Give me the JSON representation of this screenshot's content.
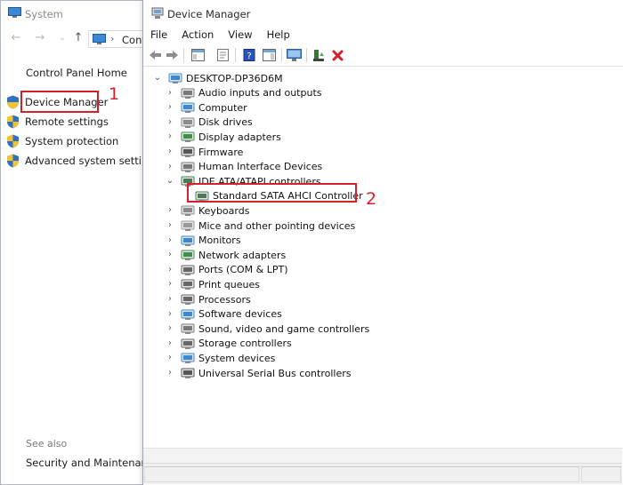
{
  "system_window": {
    "title": "System",
    "address_text": "Cont",
    "control_panel_home": "Control Panel Home",
    "tasks": [
      {
        "label": "Device Manager"
      },
      {
        "label": "Remote settings"
      },
      {
        "label": "System protection"
      },
      {
        "label": "Advanced system settings"
      }
    ],
    "see_also": "See also",
    "security_and_maintenance": "Security and Maintenance"
  },
  "device_manager": {
    "title": "Device Manager",
    "menu": [
      "File",
      "Action",
      "View",
      "Help"
    ],
    "root": "DESKTOP-DP36D6M",
    "categories": [
      {
        "label": "Audio inputs and outputs",
        "icon": "speaker-icon"
      },
      {
        "label": "Computer",
        "icon": "computer-icon"
      },
      {
        "label": "Disk drives",
        "icon": "disk-drive-icon"
      },
      {
        "label": "Display adapters",
        "icon": "display-adapter-icon"
      },
      {
        "label": "Firmware",
        "icon": "firmware-chip-icon"
      },
      {
        "label": "Human Interface Devices",
        "icon": "hid-icon"
      },
      {
        "label": "IDE ATA/ATAPI controllers",
        "icon": "ide-controller-icon",
        "expanded": true,
        "children": [
          {
            "label": "Standard SATA AHCI Controller",
            "icon": "sata-controller-icon"
          }
        ]
      },
      {
        "label": "Keyboards",
        "icon": "keyboard-icon"
      },
      {
        "label": "Mice and other pointing devices",
        "icon": "mouse-icon"
      },
      {
        "label": "Monitors",
        "icon": "monitor-icon"
      },
      {
        "label": "Network adapters",
        "icon": "network-adapter-icon"
      },
      {
        "label": "Ports (COM & LPT)",
        "icon": "port-icon"
      },
      {
        "label": "Print queues",
        "icon": "printer-icon"
      },
      {
        "label": "Processors",
        "icon": "processor-icon"
      },
      {
        "label": "Software devices",
        "icon": "software-device-icon"
      },
      {
        "label": "Sound, video and game controllers",
        "icon": "sound-controller-icon"
      },
      {
        "label": "Storage controllers",
        "icon": "storage-controller-icon"
      },
      {
        "label": "System devices",
        "icon": "system-devices-icon"
      },
      {
        "label": "Universal Serial Bus controllers",
        "icon": "usb-icon"
      }
    ]
  },
  "annotations": {
    "step1": "1",
    "step2": "2"
  },
  "colors": {
    "highlight": "#d51f2a",
    "link_text": "#1b1b1b"
  }
}
